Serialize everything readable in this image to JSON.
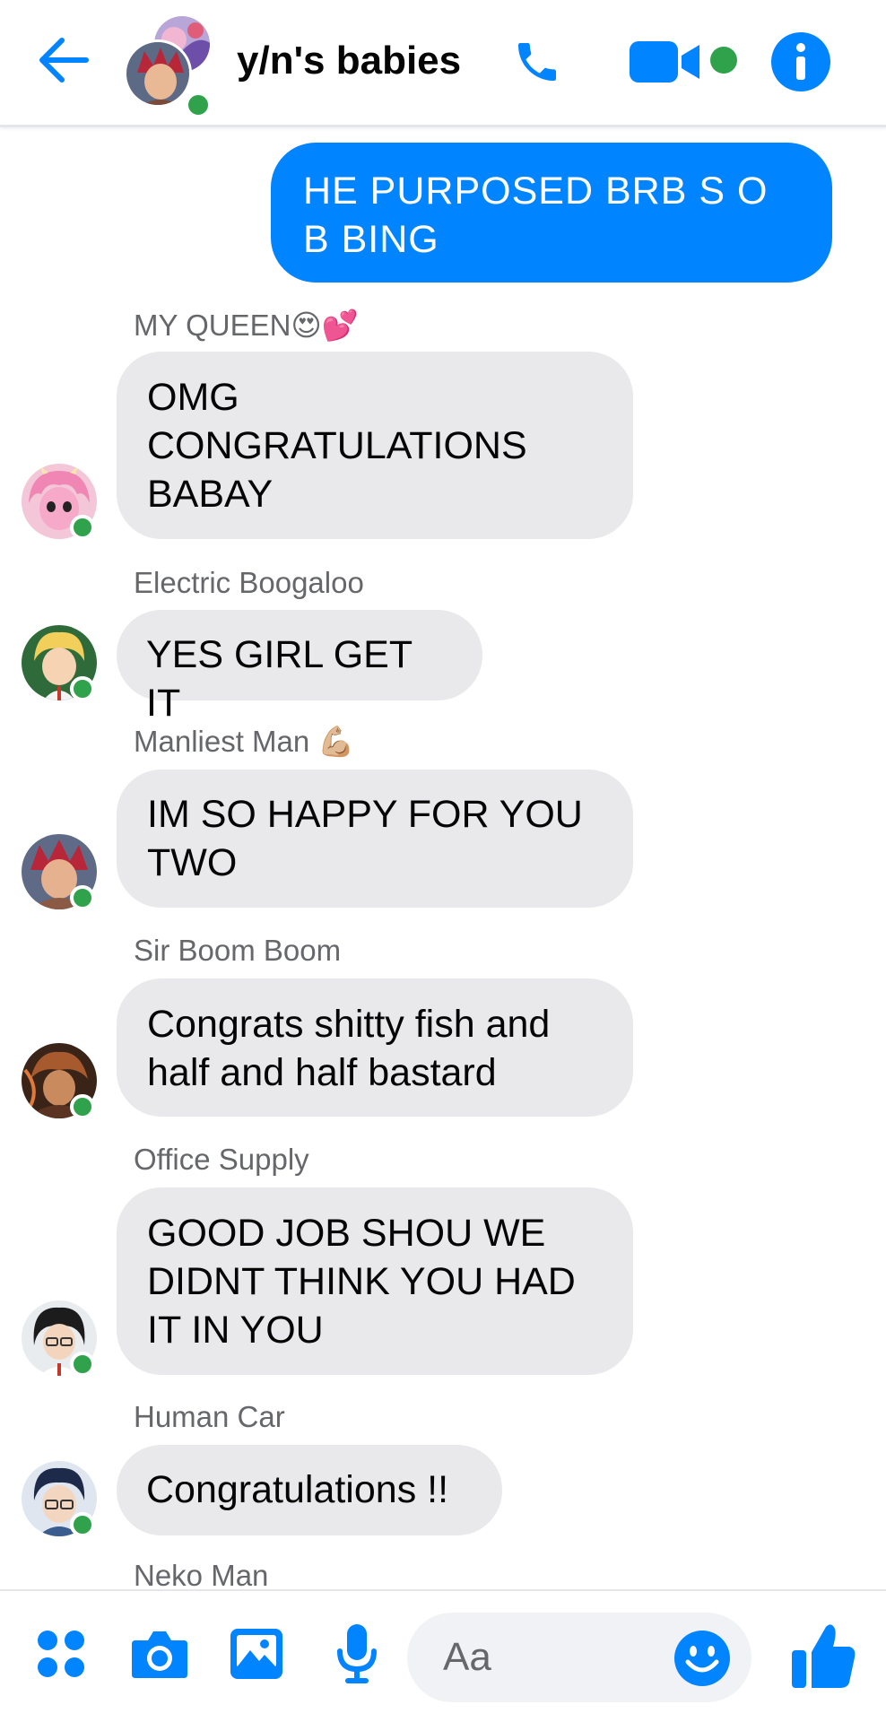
{
  "header": {
    "title": "y/n's babies",
    "icons": {
      "back": "arrow-left-icon",
      "call": "phone-icon",
      "video": "video-camera-icon",
      "info": "info-icon"
    }
  },
  "messages": [
    {
      "type": "outgoing",
      "text": "HE PURPOSED BRB S O B BING"
    },
    {
      "type": "incoming",
      "sender": "MY QUEEN😍💕",
      "text": "OMG CONGRATULATIONS BABAY",
      "avatar": "pink-hair-avatar"
    },
    {
      "type": "incoming",
      "sender": "Electric Boogaloo",
      "text": "YES GIRL GET IT",
      "avatar": "blonde-hair-avatar"
    },
    {
      "type": "incoming",
      "sender": "Manliest Man 💪🏼",
      "text": "IM SO HAPPY FOR YOU TWO",
      "avatar": "red-hair-avatar"
    },
    {
      "type": "incoming",
      "sender": "Sir Boom Boom",
      "text": "Congrats shitty fish and half and half bastard",
      "avatar": "blast-avatar"
    },
    {
      "type": "incoming",
      "sender": "Office Supply",
      "text": "GOOD JOB SHOU WE DIDNT THINK YOU HAD IT IN YOU",
      "avatar": "black-hair-avatar"
    },
    {
      "type": "incoming",
      "sender": "Human Car",
      "text": "Congratulations !!",
      "avatar": "glasses-avatar"
    },
    {
      "type": "incoming",
      "sender": "Neko Man"
    }
  ],
  "composer": {
    "placeholder": "Aa",
    "icons": {
      "apps": "apps-grid-icon",
      "camera": "camera-icon",
      "gallery": "image-icon",
      "mic": "microphone-icon",
      "emoji": "smiley-icon",
      "like": "thumbs-up-icon"
    }
  },
  "colors": {
    "accent": "#0084ff",
    "online": "#31a24c",
    "incoming_bubble": "#e9e9eb",
    "sender_text": "#65676b"
  }
}
